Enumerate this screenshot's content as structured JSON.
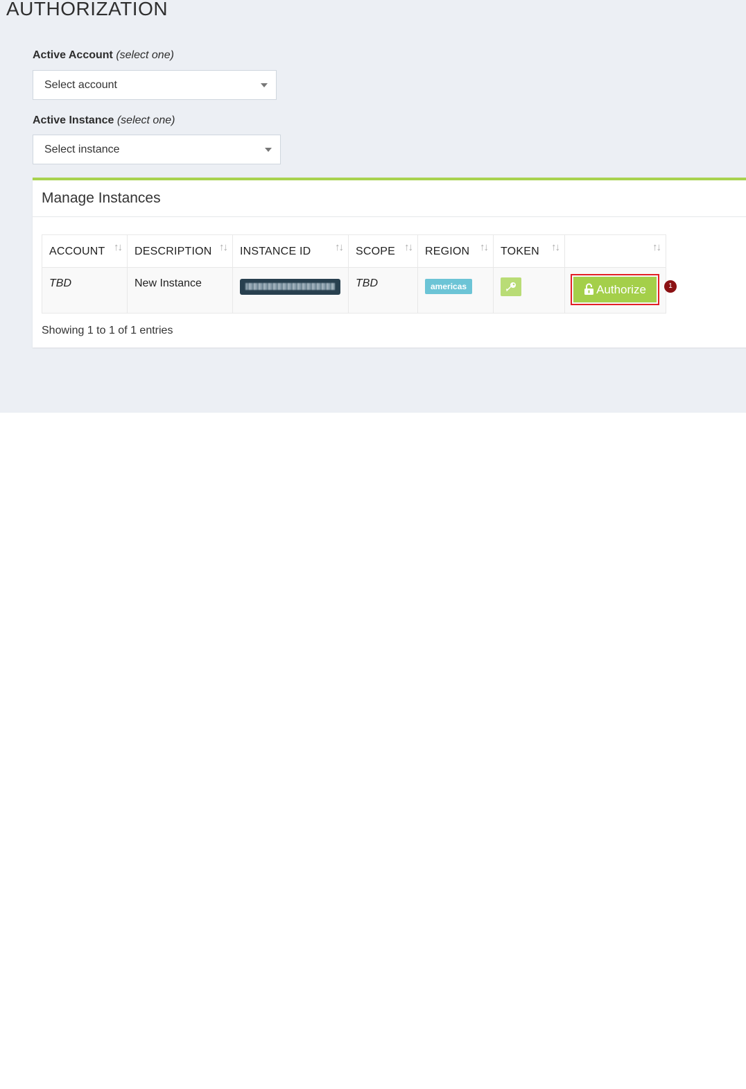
{
  "page": {
    "title": "AUTHORIZATION"
  },
  "account_field": {
    "label": "Active Account",
    "hint": "(select one)",
    "value": "Select account"
  },
  "instance_field": {
    "label": "Active Instance",
    "hint": "(select one)",
    "value": "Select instance"
  },
  "panel": {
    "title": "Manage Instances",
    "columns": [
      "ACCOUNT",
      "DESCRIPTION",
      "INSTANCE ID",
      "SCOPE",
      "REGION",
      "TOKEN",
      ""
    ],
    "rows": [
      {
        "account": "TBD",
        "description": "New Instance",
        "instance_id": "",
        "scope": "TBD",
        "region": "americas",
        "token_icon": "key-icon",
        "action": "Authorize"
      }
    ],
    "footer": "Showing 1 to 1 of 1 entries"
  },
  "annotation": {
    "marker": "1"
  },
  "colors": {
    "accent_green": "#a4cf4a",
    "region_badge": "#6cc4d6",
    "highlight_red": "#e21f26",
    "marker_red": "#8b1113"
  }
}
